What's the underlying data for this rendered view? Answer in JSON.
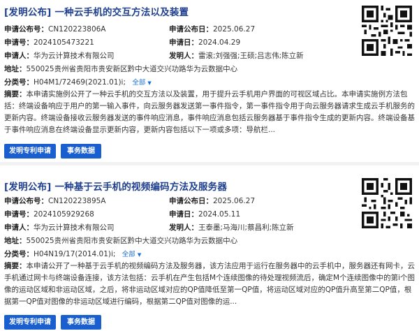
{
  "results": [
    {
      "title": "[发明公布] 一种云手机的交互方法以及装置",
      "fields": {
        "pub_no_label": "申请公布号：",
        "pub_no": "CN120223806A",
        "pub_date_label": "申请公布日：",
        "pub_date": "2025.06.27",
        "app_no_label": "申请号：",
        "app_no": "2024105473221",
        "app_date_label": "申请日：",
        "app_date": "2024.04.29",
        "applicant_label": "申请人：",
        "applicant": "华为云计算技术有限公司",
        "inventor_label": "发明人：",
        "inventor": "雷滚;刘强强;王硕;吕志伟;陈立新",
        "address_label": "地址：",
        "address": "550025贵州省贵阳市贵安新区黔中大道交兴功路华为云数据中心",
        "class_label": "分类号：",
        "class": "H04M1/72469(2021.01)i;",
        "all_label": "全部"
      },
      "abstract_label": "摘要：",
      "abstract": "本申请实施例公开了一种云手机的交互方法以及装置，用于提升云手机用户界面的可视区域占比。本申请实施例方法包括：终端设备响应于用户的第一输入事件，向云服务器发送第一事件指令，第一事件指令用于向云服务器请求生成云手机服务的更新内容。终端设备接收云服务器发送的事件响应消息，事件响应消息包括云服务器基于事件指令生成的更新内容。终端设备基于事件响应消息在终端设备显示更新内容，更新内容包括以下一项或多项：导航栏...",
      "buttons": {
        "apply": "发明专利申请",
        "status": "事务数据"
      }
    },
    {
      "title": "[发明公布] 一种基于云手机的视频编码方法及服务器",
      "fields": {
        "pub_no_label": "申请公布号：",
        "pub_no": "CN120223895A",
        "pub_date_label": "申请公布日：",
        "pub_date": "2025.06.27",
        "app_no_label": "申请号：",
        "app_no": "2024105929268",
        "app_date_label": "申请日：",
        "app_date": "2024.05.11",
        "applicant_label": "申请人：",
        "applicant": "华为云计算技术有限公司",
        "inventor_label": "发明人：",
        "inventor": "王泰墨;马海川;蔡昌利;陈立新",
        "address_label": "地址：",
        "address": "550025贵州省贵阳市贵安新区黔中大道交兴功路华为云数据中心",
        "class_label": "分类号：",
        "class": "H04N19/17(2014.01)i;",
        "all_label": "全部"
      },
      "abstract_label": "摘要：",
      "abstract": "本申请公开了一种基于云手机的视频编码方法及服务器，该方法应用于运行在服务器中的云手机中，服务器还有网卡，云手机通过网卡与终端设备连接，该方法包括：云手机在产生包括M个连续图像的待处理视频流后，确定M个连续图像中的第i个图像的运动区域和非运动区域，之后，将非运动区域对应的QP值降低至第一QP值，将运动区域对应的QP值升高至第二QP值，根据第一QP值对图像的非运动区域进行编码，根据第二QP值对图像的运...",
      "buttons": {
        "apply": "发明专利申请",
        "status": "事务数据"
      }
    }
  ]
}
